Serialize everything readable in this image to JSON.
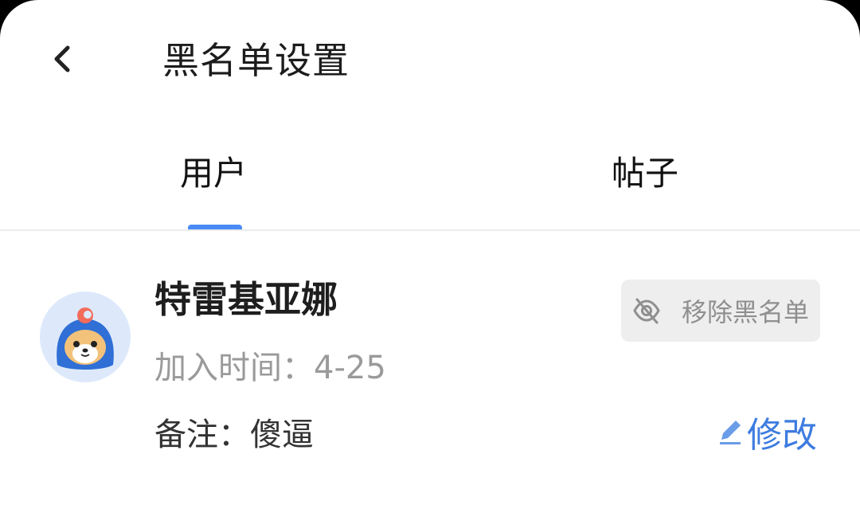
{
  "header": {
    "back_icon": "chevron-left-icon",
    "title": "黑名单设置"
  },
  "tabs": [
    {
      "label": "用户",
      "active": true
    },
    {
      "label": "帖子",
      "active": false
    }
  ],
  "accent_color": "#4a8af4",
  "blocked_user": {
    "avatar_icon": "shiba-mascot-avatar",
    "name": "特雷基亚娜",
    "join_time": "加入时间：4-25",
    "note": "备注：傻逼",
    "remove_label": "移除黑名单",
    "remove_icon": "eye-off-icon",
    "edit_label": "修改",
    "edit_icon": "pencil-icon"
  }
}
